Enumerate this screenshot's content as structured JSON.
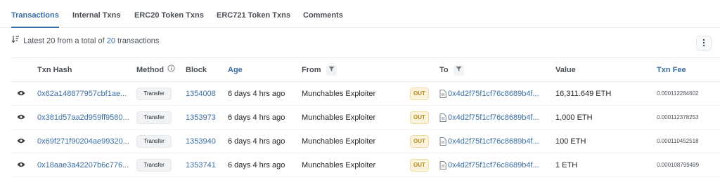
{
  "tabs": [
    {
      "label": "Transactions",
      "active": true
    },
    {
      "label": "Internal Txns",
      "active": false
    },
    {
      "label": "ERC20 Token Txns",
      "active": false
    },
    {
      "label": "ERC721 Token Txns",
      "active": false
    },
    {
      "label": "Comments",
      "active": false
    }
  ],
  "summary": {
    "prefix": "Latest 20 from a total of",
    "count": "20",
    "suffix": "transactions"
  },
  "table": {
    "headers": {
      "txn_hash": "Txn Hash",
      "method": "Method",
      "block": "Block",
      "age": "Age",
      "from": "From",
      "to": "To",
      "value": "Value",
      "txn_fee": "Txn Fee"
    },
    "rows": [
      {
        "hash": "0x62a148877957cbf1ae...",
        "method": "Transfer",
        "block": "1354008",
        "age": "6 days 4 hrs ago",
        "from": "Munchables Exploiter",
        "direction": "OUT",
        "to": "0x4d2f75f1cf76c8689b4f...",
        "value": "16,311.649 ETH",
        "fee": "0.000112284602"
      },
      {
        "hash": "0x381d57aa2d959ff9580...",
        "method": "Transfer",
        "block": "1353973",
        "age": "6 days 4 hrs ago",
        "from": "Munchables Exploiter",
        "direction": "OUT",
        "to": "0x4d2f75f1cf76c8689b4f...",
        "value": "1,000 ETH",
        "fee": "0.000112378253"
      },
      {
        "hash": "0x69f271f90204ae99320...",
        "method": "Transfer",
        "block": "1353940",
        "age": "6 days 4 hrs ago",
        "from": "Munchables Exploiter",
        "direction": "OUT",
        "to": "0x4d2f75f1cf76c8689b4f...",
        "value": "100 ETH",
        "fee": "0.000110452518"
      },
      {
        "hash": "0x18aae3a42207b6c776...",
        "method": "Transfer",
        "block": "1353741",
        "age": "6 days 4 hrs ago",
        "from": "Munchables Exploiter",
        "direction": "OUT",
        "to": "0x4d2f75f1cf76c8689b4f...",
        "value": "1 ETH",
        "fee": "0.000108799499"
      }
    ]
  },
  "icons": {
    "sort": "sort-descending-icon",
    "more": "more-vertical-icon",
    "info": "info-circle-icon",
    "filter": "filter-icon",
    "eye": "eye-icon",
    "document": "document-icon"
  },
  "colors": {
    "accent": "#3a6ea5",
    "out_badge_bg": "#fbf3dc",
    "out_badge_text": "#b58a1b"
  }
}
